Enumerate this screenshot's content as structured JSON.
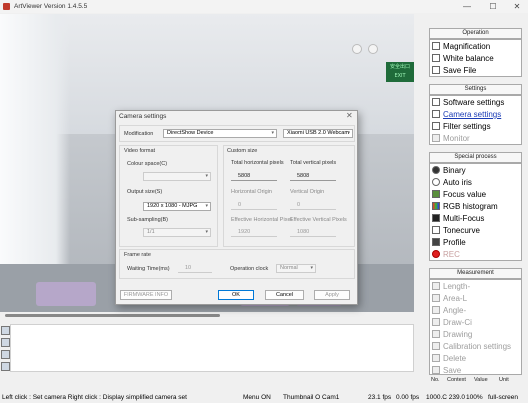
{
  "window": {
    "title": "ArtViewer Version 1.4.5.5",
    "minimize_glyph": "—",
    "maximize_glyph": "☐",
    "close_glyph": "✕"
  },
  "viewport": {
    "exit_sign_line1": "安全出口",
    "exit_sign_line2": "EXIT"
  },
  "right_panel": {
    "operation": {
      "header": "Operation",
      "items": [
        {
          "label": "Magnification",
          "icon": "magnifier-icon",
          "state": "normal"
        },
        {
          "label": "White balance",
          "icon": "white-balance-icon",
          "state": "normal"
        },
        {
          "label": "Save File",
          "icon": "save-file-icon",
          "state": "normal"
        }
      ]
    },
    "settings": {
      "header": "Settings",
      "items": [
        {
          "label": "Software settings",
          "icon": "software-settings-icon",
          "state": "normal"
        },
        {
          "label": "Camera settings",
          "icon": "camera-settings-icon",
          "state": "selected"
        },
        {
          "label": "Filter settings",
          "icon": "filter-settings-icon",
          "state": "normal"
        },
        {
          "label": "Monitor",
          "icon": "monitor-icon",
          "state": "disabled"
        }
      ]
    },
    "special": {
      "header": "Special process",
      "items": [
        {
          "label": "Binary",
          "icon": "binary-icon",
          "state": "normal"
        },
        {
          "label": "Auto iris",
          "icon": "auto-iris-icon",
          "state": "normal"
        },
        {
          "label": "Focus value",
          "icon": "focus-value-icon",
          "state": "normal"
        },
        {
          "label": "RGB histogram",
          "icon": "rgb-histogram-icon",
          "state": "normal"
        },
        {
          "label": "Multi-Focus",
          "icon": "multi-focus-icon",
          "state": "normal"
        },
        {
          "label": "Tonecurve",
          "icon": "tonecurve-icon",
          "state": "normal"
        },
        {
          "label": "Profile",
          "icon": "profile-icon",
          "state": "normal"
        },
        {
          "label": "REC",
          "icon": "rec-icon",
          "state": "rec"
        }
      ]
    },
    "measurement": {
      "header": "Measurement",
      "items": [
        {
          "label": "Length-",
          "icon": "length-icon"
        },
        {
          "label": "Area-L",
          "icon": "area-icon"
        },
        {
          "label": "Angle-",
          "icon": "angle-icon"
        },
        {
          "label": "Draw-Ci",
          "icon": "draw-circle-icon"
        },
        {
          "label": "Drawing",
          "icon": "drawing-icon"
        },
        {
          "label": "Calibration settings",
          "icon": "calibration-icon"
        },
        {
          "label": "Delete",
          "icon": "delete-icon"
        },
        {
          "label": "Save",
          "icon": "save-icon"
        }
      ],
      "columns": [
        "No.",
        "Context",
        "Value",
        "Unit"
      ]
    }
  },
  "dialog": {
    "title": "Camera settings",
    "close_glyph": "✕",
    "modification_label": "Modification",
    "modification_value": "DirectShow Device",
    "device_value": "Xiaomi USB 2.0 Webcam",
    "video_format": {
      "title": "Video format",
      "colour_space_label": "Colour space(C)",
      "colour_space_value": "",
      "output_size_label": "Output size(S)",
      "output_size_value": "1920 x 1080 - MJPG",
      "sub_sampling_label": "Sub-sampling(B)",
      "sub_sampling_value": "1/1"
    },
    "custom_size": {
      "title": "Custom size",
      "total_h_label": "Total horizontal pixels",
      "total_h_value": "5808",
      "total_v_label": "Total vertical pixels",
      "total_v_value": "5808",
      "h_origin_label": "Horizontal Origin",
      "h_origin_value": "0",
      "v_origin_label": "Vertical Origin",
      "v_origin_value": "0",
      "eff_h_label": "Effective Horizontal Pixel",
      "eff_h_value": "1920",
      "eff_v_label": "Effective Vertical Pixels",
      "eff_v_value": "1080"
    },
    "frame_rate": {
      "title": "Frame rate",
      "waiting_label": "Waiting Time(ms)",
      "waiting_value": "10",
      "op_clock_label": "Operation clock",
      "op_clock_value": "Normal"
    },
    "firmware_button": "FIRMWARE INFO",
    "ok_button": "OK",
    "cancel_button": "Cancel",
    "apply_button": "Apply"
  },
  "status_bar": {
    "hint": "Left click : Set camera  Right click : Display simplified camera set",
    "menu": "Menu ON",
    "thumbnail": "Thumbnail O Cam1",
    "fps1": "23.1 fps",
    "fps2": "0.00 fps",
    "coords": "1000.C 239.0",
    "zoom": "100%",
    "mode": "full-screen"
  },
  "colors": {
    "accent": "#0078d7",
    "selected_link": "#1a3bb5",
    "rec_red": "#e02020",
    "exit_green": "#1f6b3a"
  }
}
